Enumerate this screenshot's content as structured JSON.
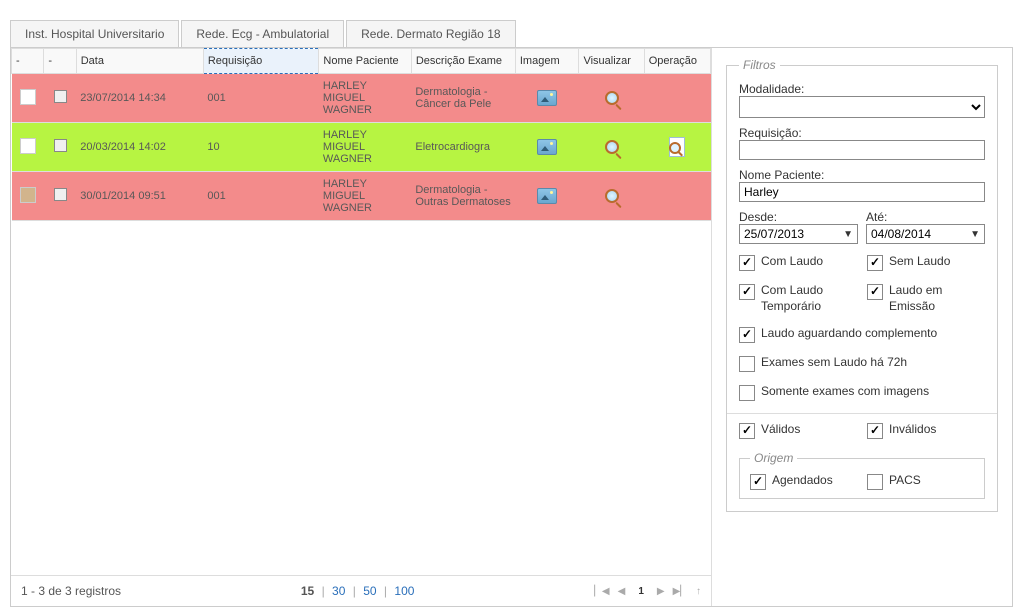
{
  "tabs": [
    {
      "label": "Inst. Hospital Universitario"
    },
    {
      "label": "Rede. Ecg - Ambulatorial"
    },
    {
      "label": "Rede. Dermato Região 18"
    }
  ],
  "table": {
    "headers": {
      "mark": "-",
      "chk": "-",
      "data": "Data",
      "requisicao": "Requisição",
      "nome": "Nome Paciente",
      "descricao": "Descrição Exame",
      "imagem": "Imagem",
      "visualizar": "Visualizar",
      "operacao": "Operação"
    },
    "rows": [
      {
        "swatch": "white",
        "class": "row-pink",
        "data": "23/07/2014 14:34",
        "req": "001",
        "nome": "HARLEY MIGUEL WAGNER",
        "desc": "Dermatologia - Câncer da Pele",
        "op": ""
      },
      {
        "swatch": "white",
        "class": "row-green",
        "data": "20/03/2014 14:02",
        "req": "10",
        "nome": "HARLEY MIGUEL WAGNER",
        "desc": "Eletrocardiogra",
        "op": "doc"
      },
      {
        "swatch": "tan",
        "class": "row-pink",
        "data": "30/01/2014 09:51",
        "req": "001",
        "nome": "HARLEY MIGUEL WAGNER",
        "desc": "Dermatologia - Outras Dermatoses",
        "op": ""
      }
    ]
  },
  "pager": {
    "status": "1 - 3 de 3 registros",
    "sizes": [
      "15",
      "30",
      "50",
      "100"
    ],
    "active_size": "15",
    "page": "1"
  },
  "filters": {
    "legend": "Filtros",
    "modalidade_label": "Modalidade:",
    "requisicao_label": "Requisição:",
    "nome_label": "Nome Paciente:",
    "nome_value": "Harley",
    "desde_label": "Desde:",
    "desde_value": "25/07/2013",
    "ate_label": "Até:",
    "ate_value": "04/08/2014",
    "checks": {
      "com_laudo": "Com Laudo",
      "sem_laudo": "Sem Laudo",
      "com_laudo_temp": "Com Laudo Temporário",
      "laudo_emissao": "Laudo em Emissão",
      "laudo_aguardando": "Laudo aguardando complemento",
      "exames_72h": "Exames sem Laudo há 72h",
      "somente_imagens": "Somente exames com imagens",
      "validos": "Válidos",
      "invalidos": "Inválidos"
    },
    "origem": {
      "legend": "Origem",
      "agendados": "Agendados",
      "pacs": "PACS"
    }
  }
}
